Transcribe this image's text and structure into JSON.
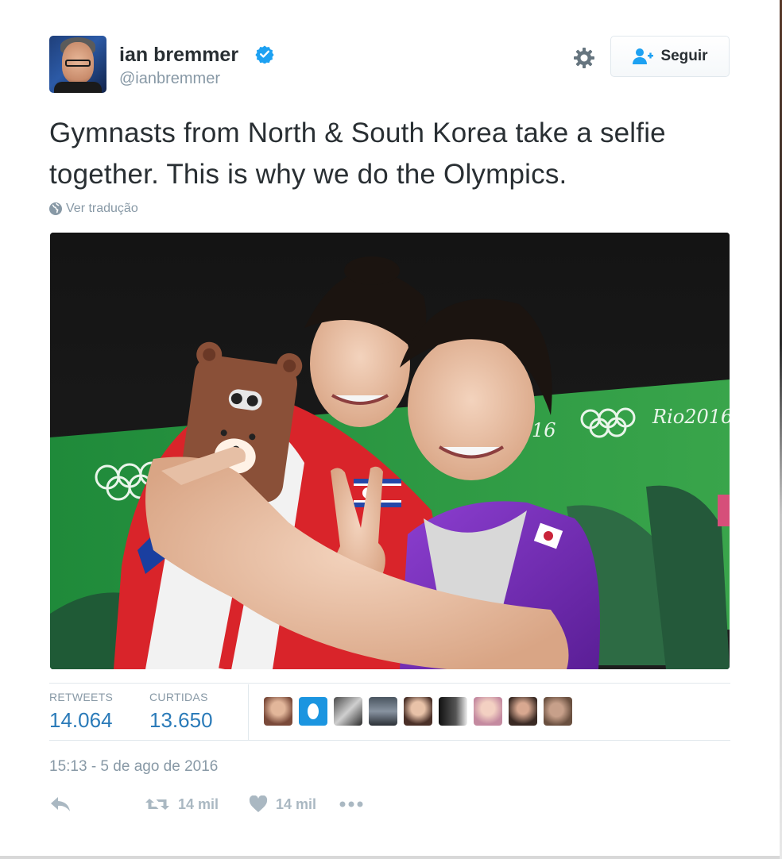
{
  "user": {
    "name": "ian bremmer",
    "handle": "@ianbremmer",
    "verified": true
  },
  "follow_button": {
    "label": "Seguir"
  },
  "tweet": {
    "text": "Gymnasts from North & South Korea take a selfie together. This is why we do the Olympics.",
    "translate_label": "Ver tradução",
    "timestamp": "15:13 - 5 de ago de 2016"
  },
  "stats": {
    "retweets_label": "RETWEETS",
    "retweets_value": "14.064",
    "likes_label": "CURTIDAS",
    "likes_value": "13.650"
  },
  "likers": [
    "liker-avatar",
    "liker-avatar",
    "liker-avatar",
    "liker-avatar",
    "liker-avatar",
    "liker-avatar",
    "liker-avatar",
    "liker-avatar",
    "liker-avatar"
  ],
  "actions": {
    "retweet_count": "14 mil",
    "like_count": "14 mil"
  },
  "photo": {
    "olympic_text": "Rio2016",
    "olympic_text_partial": "16"
  },
  "colors": {
    "link_blue": "#2b7bb9",
    "verified_blue": "#1da1f2",
    "muted": "#8899a6",
    "arena_green": "#2e9a44"
  }
}
